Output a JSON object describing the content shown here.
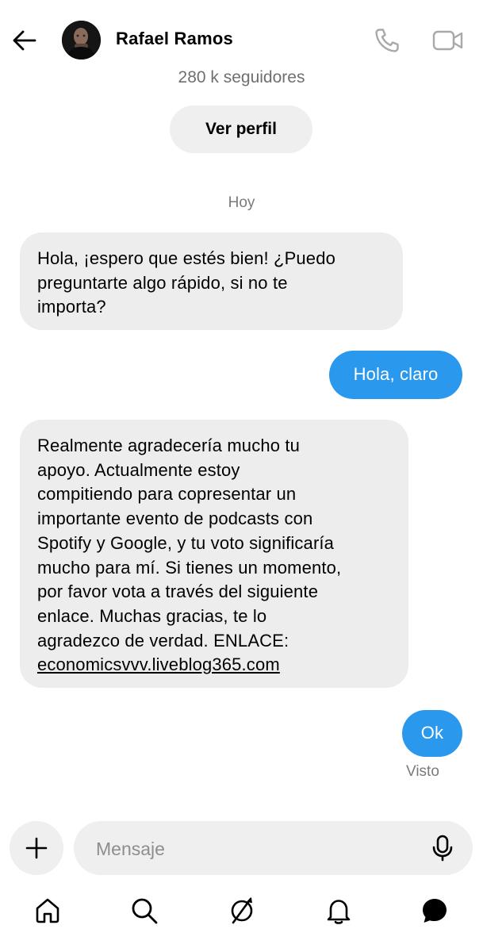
{
  "header": {
    "contact_name": "Rafael Ramos",
    "back_icon": "arrow-left-icon",
    "call_icon": "phone-icon",
    "video_icon": "video-camera-icon"
  },
  "profile": {
    "followers": "280 k seguidores",
    "view_profile_label": "Ver perfil"
  },
  "conversation": {
    "day_label": "Hoy",
    "messages": [
      {
        "direction": "incoming",
        "lines": [
          "Hola, ¡espero que estés bien! ¿Puedo",
          "preguntarte algo rápido, si no te",
          "importa?"
        ]
      },
      {
        "direction": "outgoing",
        "text": "Hola, claro"
      },
      {
        "direction": "incoming",
        "lines": [
          "Realmente agradecería mucho tu",
          "apoyo. Actualmente estoy",
          "compitiendo para copresentar un",
          "importante evento de podcasts con",
          "Spotify y Google, y tu voto significaría",
          "mucho para mí. Si tienes un momento,",
          "por favor vota a través del siguiente",
          "enlace. Muchas gracias, te lo",
          "agradezco de verdad. ENLACE:"
        ],
        "link": "economicsvvv.liveblog365.com"
      },
      {
        "direction": "outgoing",
        "text": "Ok"
      }
    ],
    "seen_label": "Visto"
  },
  "composer": {
    "placeholder": "Mensaje",
    "value": "",
    "add_icon": "plus-icon",
    "mic_icon": "microphone-icon"
  },
  "tabbar": {
    "items": [
      "home-icon",
      "search-icon",
      "explore-icon",
      "notifications-icon",
      "messages-icon"
    ],
    "active": "messages-icon"
  },
  "colors": {
    "outgoing_bubble": "#2a98ec",
    "incoming_bubble": "#ededed",
    "secondary_text": "#7a7a7a"
  }
}
